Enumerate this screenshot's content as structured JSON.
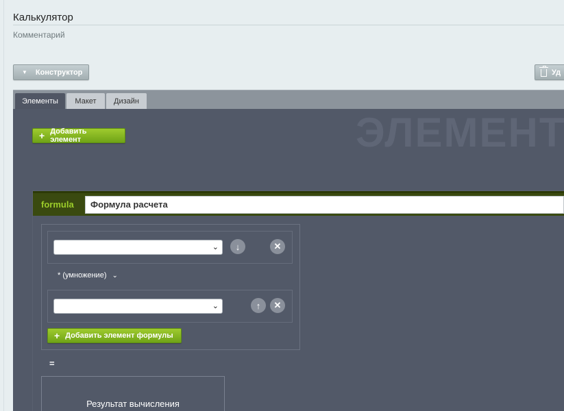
{
  "header": {
    "title": "Калькулятор",
    "comment": "Комментарий"
  },
  "toolbar": {
    "constructor_label": "Конструктор",
    "delete_label": "Уд"
  },
  "tabs": [
    {
      "label": "Элементы",
      "active": true
    },
    {
      "label": "Макет",
      "active": false
    },
    {
      "label": "Дизайн",
      "active": false
    }
  ],
  "main": {
    "watermark": "ЭЛЕМЕНТ",
    "add_element_label": "Добавить элемент",
    "formula": {
      "key": "formula",
      "title": "Формула расчета",
      "operand_1_value": "",
      "operand_2_value": "",
      "operator": "* (умножение)",
      "add_formula_element_label": "Добавить элемент формулы",
      "equals": "=",
      "result_label": "Результат вычисления"
    }
  },
  "colors": {
    "accent_green": "#7cb51e",
    "panel_bg": "#525968",
    "formula_header_bg": "#3a4a10"
  },
  "icons": {
    "constructor": "triangle-down-icon",
    "delete": "trash-icon",
    "add": "plus-icon",
    "move_down": "arrow-down-icon",
    "move_up": "arrow-up-icon",
    "remove": "close-icon",
    "select": "chevron-down-icon"
  }
}
